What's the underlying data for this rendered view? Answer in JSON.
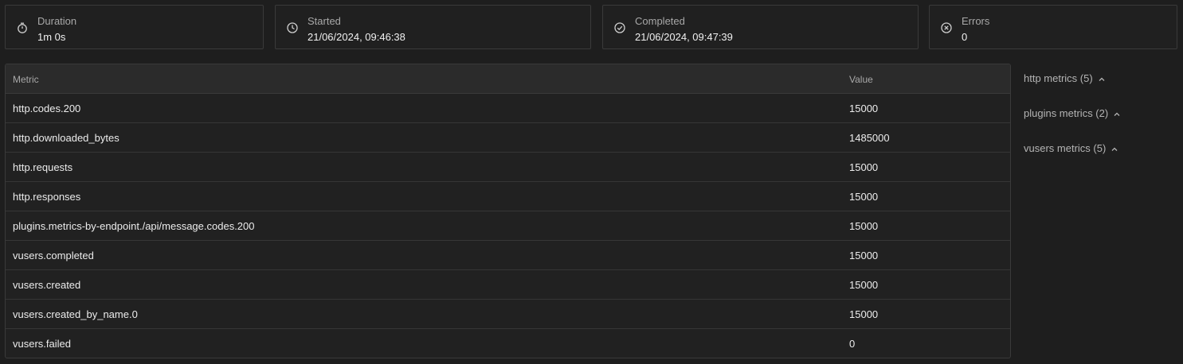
{
  "stats": [
    {
      "label": "Duration",
      "value": "1m 0s",
      "icon": "stopwatch-icon"
    },
    {
      "label": "Started",
      "value": "21/06/2024, 09:46:38",
      "icon": "clock-icon"
    },
    {
      "label": "Completed",
      "value": "21/06/2024, 09:47:39",
      "icon": "check-circle-icon"
    },
    {
      "label": "Errors",
      "value": "0",
      "icon": "x-circle-icon"
    }
  ],
  "table": {
    "headers": {
      "metric": "Metric",
      "value": "Value"
    },
    "rows": [
      {
        "metric": "http.codes.200",
        "value": "15000"
      },
      {
        "metric": "http.downloaded_bytes",
        "value": "1485000"
      },
      {
        "metric": "http.requests",
        "value": "15000"
      },
      {
        "metric": "http.responses",
        "value": "15000"
      },
      {
        "metric": "plugins.metrics-by-endpoint./api/message.codes.200",
        "value": "15000"
      },
      {
        "metric": "vusers.completed",
        "value": "15000"
      },
      {
        "metric": "vusers.created",
        "value": "15000"
      },
      {
        "metric": "vusers.created_by_name.0",
        "value": "15000"
      },
      {
        "metric": "vusers.failed",
        "value": "0"
      }
    ]
  },
  "sidebar": {
    "groups": [
      {
        "label": "http metrics (5)"
      },
      {
        "label": "plugins metrics (2)"
      },
      {
        "label": "vusers metrics (5)"
      }
    ]
  }
}
